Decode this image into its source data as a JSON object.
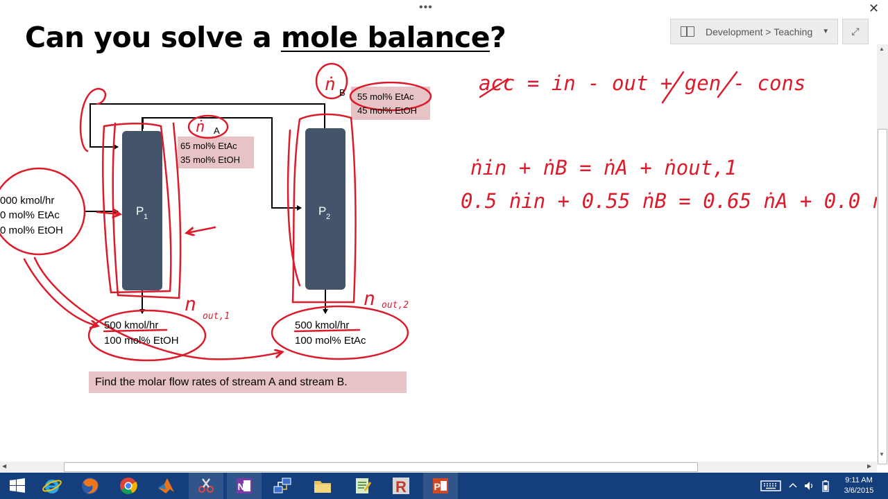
{
  "window": {
    "more_dots": "•••",
    "close_glyph": "✕",
    "notebook_picker": {
      "label": "Development > Teaching",
      "caret": "▼"
    },
    "expand_glyph": "⤢"
  },
  "page": {
    "title_prefix": "Can you solve a ",
    "title_underlined": "mole balance",
    "title_suffix": "?"
  },
  "diagram": {
    "feed_line1": "000 kmol/hr",
    "feed_line2": "0 mol% EtAc",
    "feed_line3": "0 mol% EtOH",
    "unit1_label": "P",
    "unit1_sub": "1",
    "unit2_label": "P",
    "unit2_sub": "2",
    "streamA_line1": "65 mol% EtAc",
    "streamA_line2": "35 mol% EtOH",
    "streamA_letter": "A",
    "streamB_line1": "55 mol% EtAc",
    "streamB_line2": "45 mol% EtOH",
    "streamB_letter": "B",
    "out1_line1": "500 kmol/hr",
    "out1_line2": "100 mol% EtOH",
    "out2_line1": "500 kmol/hr",
    "out2_line2": "100 mol% EtAc",
    "question": "Find the molar flow rates of stream A and stream B.",
    "ink_color": "#dc1b2a",
    "box_color": "#e7c3c5",
    "unit_color": "#44546a"
  },
  "handwriting": {
    "n_out1": "n",
    "n_out1_sub": "out,1",
    "n_out2": "n",
    "n_out2_sub": "out,2",
    "balance": "acc = in - out + gen - cons",
    "eq1": "ṅin + ṅB = ṅA + ṅout,1",
    "eq2": "0.5 ṅin + 0.55 ṅB = 0.65 ṅA + 0.0 n"
  },
  "taskbar": {
    "apps": [
      {
        "name": "start",
        "icon": "windows-logo-icon"
      },
      {
        "name": "internet-explorer",
        "icon": "ie-icon"
      },
      {
        "name": "firefox",
        "icon": "firefox-icon"
      },
      {
        "name": "chrome",
        "icon": "chrome-icon"
      },
      {
        "name": "matlab",
        "icon": "matlab-icon"
      },
      {
        "name": "snipping-tool",
        "icon": "scissors-icon"
      },
      {
        "name": "onenote",
        "icon": "onenote-icon"
      },
      {
        "name": "network",
        "icon": "network-icon"
      },
      {
        "name": "file-explorer",
        "icon": "folder-icon"
      },
      {
        "name": "notepad",
        "icon": "notepad-icon"
      },
      {
        "name": "r-app",
        "icon": "r-icon"
      },
      {
        "name": "powerpoint",
        "icon": "powerpoint-icon"
      }
    ],
    "time": "9:11 AM",
    "date": "3/6/2015"
  }
}
